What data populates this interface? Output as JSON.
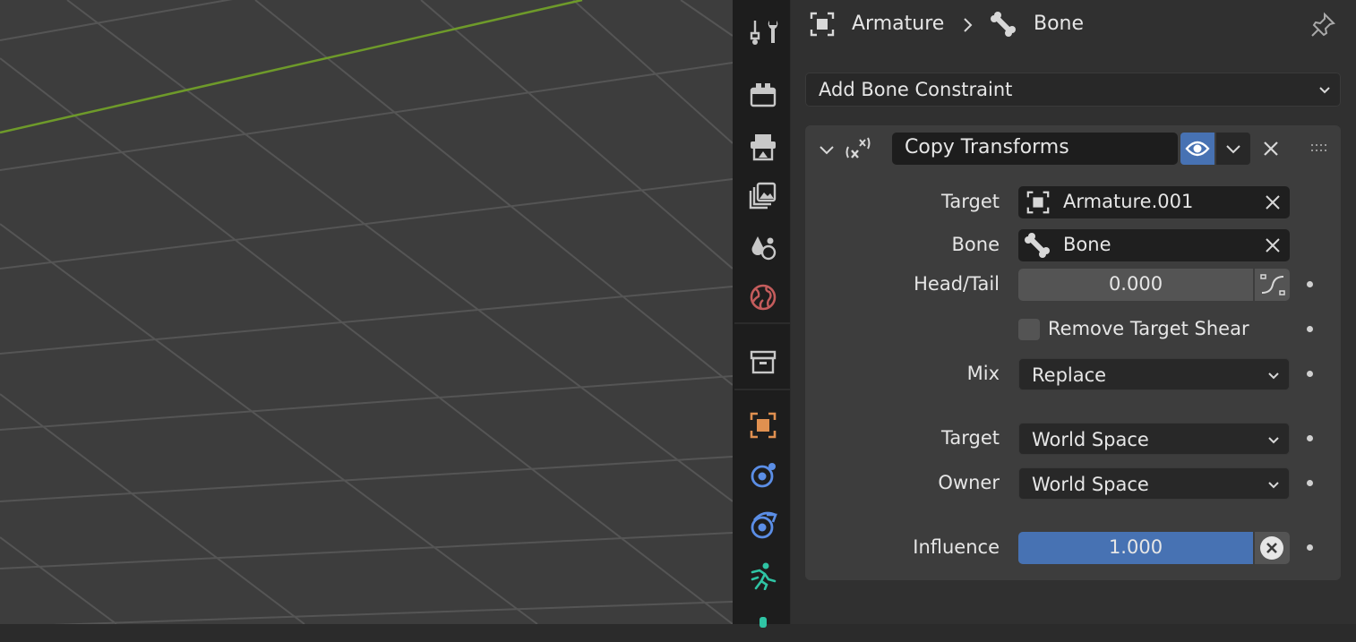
{
  "header": {
    "object_name": "Armature",
    "bone_name": "Bone"
  },
  "add_constraint_label": "Add Bone Constraint",
  "constraint": {
    "name": "Copy Transforms",
    "target_label": "Target",
    "target_value": "Armature.001",
    "bone_label": "Bone",
    "bone_value": "Bone",
    "headtail_label": "Head/Tail",
    "headtail_value": "0.000",
    "remove_shear_label": "Remove Target Shear",
    "remove_shear_checked": false,
    "mix_label": "Mix",
    "mix_value": "Replace",
    "target_space_label": "Target",
    "target_space_value": "World Space",
    "owner_space_label": "Owner",
    "owner_space_value": "World Space",
    "influence_label": "Influence",
    "influence_value": "1.000",
    "influence_fraction": 1.0
  },
  "tabs": [
    "tool-icon",
    "render-icon",
    "output-icon",
    "view-layer-icon",
    "scene-icon",
    "world-icon",
    "collection-icon",
    "object-icon",
    "modifier-icon",
    "particles-icon",
    "bone-constraint-icon",
    "physics-icon"
  ],
  "colors": {
    "accent_blue": "#4772b3",
    "object_orange": "#e09050",
    "world_red": "#c45c5c",
    "modifier_blue": "#5b8ee6",
    "constraint_green": "#2fc4a4",
    "axis_green": "#6e9a2a"
  }
}
